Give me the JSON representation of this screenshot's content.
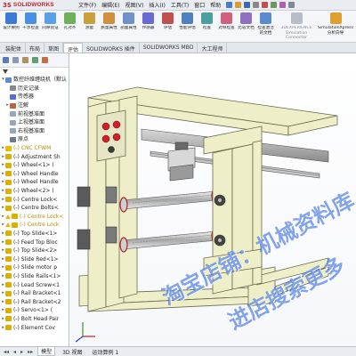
{
  "app": {
    "logo_ds": "3S",
    "logo_text": "SOLIDWORKS"
  },
  "menu": [
    "文件(F)",
    "编辑(E)",
    "视图(V)",
    "插入(I)",
    "工具(T)",
    "窗口",
    "帮助"
  ],
  "ribbon": {
    "buttons": [
      {
        "label": "设计算例",
        "color": "#3b7bd6"
      },
      {
        "label": "干涉检查",
        "color": "#4a90e2"
      },
      {
        "label": "间隙验证",
        "color": "#58a0e8"
      },
      {
        "label": "孔对齐",
        "color": "#6fb05a"
      },
      {
        "label": "测量",
        "color": "#c8a040"
      },
      {
        "label": "质量属性",
        "color": "#d09040"
      },
      {
        "label": "剖面属性",
        "color": "#7090c8"
      },
      {
        "label": "传感器",
        "color": "#6a6ad0"
      },
      {
        "label": "评估",
        "color": "#c0504d"
      },
      {
        "label": "性能评估",
        "color": "#5080c0"
      },
      {
        "label": "检查",
        "color": "#4aa0a0"
      },
      {
        "label": "对称检查",
        "color": "#d06080"
      },
      {
        "label": "比较文档",
        "color": "#9070c0"
      },
      {
        "label": "检查激活的文档",
        "color": "#5a8ad0"
      }
    ],
    "wide_button": {
      "label": "3DEXPERIENCE Simulation Connector",
      "color": "#b8bec8"
    },
    "last_button": {
      "label": "SimulationXpress 分析向导",
      "color": "#e0a030"
    }
  },
  "tabs": [
    {
      "label": "装配体",
      "active": false
    },
    {
      "label": "布局",
      "active": false
    },
    {
      "label": "草图",
      "active": false
    },
    {
      "label": "评估",
      "active": true
    },
    {
      "label": "SOLIDWORKS 插件",
      "active": false
    },
    {
      "label": "SOLIDWORKS MBD",
      "active": false
    },
    {
      "label": "大工程师",
      "active": false
    }
  ],
  "tree": {
    "root": "数控纤维缠绕机（默认",
    "items": [
      {
        "label": "历史记录",
        "level": 1,
        "icon": "history-icon",
        "color": "#888",
        "exp": ""
      },
      {
        "label": "传感器",
        "level": 1,
        "icon": "sensor-icon",
        "color": "#5a6ad0",
        "exp": ""
      },
      {
        "label": "注解",
        "level": 1,
        "icon": "annotation-icon",
        "color": "#c06040",
        "exp": "▸"
      },
      {
        "label": "前视基准面",
        "level": 1,
        "icon": "plane-icon",
        "color": "#9aa6b8",
        "exp": ""
      },
      {
        "label": "上视基准面",
        "level": 1,
        "icon": "plane-icon",
        "color": "#9aa6b8",
        "exp": ""
      },
      {
        "label": "右视基准面",
        "level": 1,
        "icon": "plane-icon",
        "color": "#9aa6b8",
        "exp": ""
      },
      {
        "label": "原点",
        "level": 1,
        "icon": "origin-icon",
        "color": "#6a7a8a",
        "exp": ""
      },
      {
        "label": "(-) CNC CFWM",
        "level": 0,
        "icon": "part-icon",
        "color": "#e0c000",
        "exp": "▸",
        "yellow": true
      },
      {
        "label": "(-) Adjustment Sh",
        "level": 0,
        "icon": "part-icon",
        "color": "#d8b000",
        "exp": "▸"
      },
      {
        "label": "(-) Wheel<1> (",
        "level": 0,
        "icon": "part-icon",
        "color": "#d8b000",
        "exp": "▸"
      },
      {
        "label": "(-) Wheel Handle",
        "level": 0,
        "icon": "part-icon",
        "color": "#d8b000",
        "exp": "▸"
      },
      {
        "label": "(-) Wheel Handle",
        "level": 0,
        "icon": "part-icon",
        "color": "#d8b000",
        "exp": "▸"
      },
      {
        "label": "(-) Wheel<2> (",
        "level": 0,
        "icon": "part-icon",
        "color": "#d8b000",
        "exp": "▸"
      },
      {
        "label": "(-) Centre Lock<",
        "level": 0,
        "icon": "part-icon",
        "color": "#d8b000",
        "exp": "▸"
      },
      {
        "label": "(-) Centre Bolts<",
        "level": 0,
        "icon": "part-icon",
        "color": "#d8b000",
        "exp": "▸"
      },
      {
        "label": "(-) Centre Lock<",
        "level": 0,
        "icon": "part-icon",
        "color": "#d8b000",
        "exp": "▸",
        "warn": true,
        "yellow": true
      },
      {
        "label": "(-) Centre Lock",
        "level": 0,
        "icon": "part-icon",
        "color": "#d8b000",
        "exp": "▸",
        "warn": true,
        "yellow": true
      },
      {
        "label": "(-) Top Slide<1>",
        "level": 0,
        "icon": "part-icon",
        "color": "#d8b000",
        "exp": "▸"
      },
      {
        "label": "(-) Feed Top Bloc",
        "level": 0,
        "icon": "part-icon",
        "color": "#d8b000",
        "exp": "▸"
      },
      {
        "label": "(-) Top Slide<2>",
        "level": 0,
        "icon": "part-icon",
        "color": "#d8b000",
        "exp": "▸"
      },
      {
        "label": "(-) Slide Red<1>",
        "level": 0,
        "icon": "part-icon",
        "color": "#d8b000",
        "exp": "▸"
      },
      {
        "label": "(-) Slide motor p",
        "level": 0,
        "icon": "part-icon",
        "color": "#d8b000",
        "exp": "▸"
      },
      {
        "label": "(-) Slide Rails<1>",
        "level": 0,
        "icon": "part-icon",
        "color": "#d8b000",
        "exp": "▸"
      },
      {
        "label": "(-) Lead Screw<1",
        "level": 0,
        "icon": "part-icon",
        "color": "#d8b000",
        "exp": "▸"
      },
      {
        "label": "(-) Rail Bracket<1",
        "level": 0,
        "icon": "part-icon",
        "color": "#d8b000",
        "exp": "▸"
      },
      {
        "label": "(-) Rail Bracket<2",
        "level": 0,
        "icon": "part-icon",
        "color": "#d8b000",
        "exp": "▸"
      },
      {
        "label": "(-) Servo<1> (",
        "level": 0,
        "icon": "part-icon",
        "color": "#d8b000",
        "exp": "▸"
      },
      {
        "label": "(-) Bolt Head Pair",
        "level": 0,
        "icon": "part-icon",
        "color": "#d8b000",
        "exp": "▸"
      },
      {
        "label": "(-) Element Cov",
        "level": 0,
        "icon": "part-icon",
        "color": "#d8b000",
        "exp": "▸"
      }
    ]
  },
  "watermark": {
    "line1": "淘宝店铺：机械资料库",
    "line2": "进店搜索更多"
  },
  "bottom_tabs": [
    {
      "label": "模型",
      "active": true
    },
    {
      "label": "3D 视图",
      "active": false
    },
    {
      "label": "运动算例 1",
      "active": false
    }
  ],
  "colors": {
    "frame_fill": "#eeeec8",
    "frame_stroke": "#6b6b50",
    "accent_red": "#d0202a"
  }
}
